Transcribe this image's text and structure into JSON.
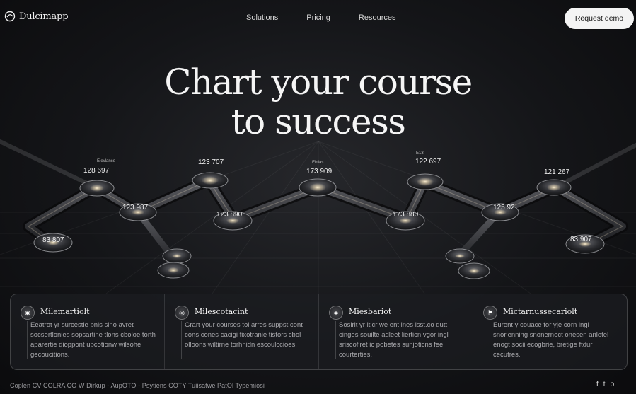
{
  "brand": {
    "name": "Dulcimapp",
    "logo_icon": "brand-logo-icon"
  },
  "nav": {
    "links": [
      "Solutions",
      "Pricing",
      "Resources"
    ],
    "cta": "Request demo"
  },
  "hero": {
    "line1": "Chart your course",
    "line2": "to success"
  },
  "milestones": [
    {
      "label": "128 697",
      "small": "Elevlance"
    },
    {
      "label": "123 987",
      "small": ""
    },
    {
      "label": "83 807",
      "small": ""
    },
    {
      "label": "123 707",
      "small": ""
    },
    {
      "label": "123 890",
      "small": ""
    },
    {
      "label": "173 909",
      "small": "Elnlas"
    },
    {
      "label": "122 697",
      "small": "E13"
    },
    {
      "label": "173 880",
      "small": ""
    },
    {
      "label": "121 267",
      "small": ""
    },
    {
      "label": "125 92",
      "small": ""
    },
    {
      "label": "83 907",
      "small": ""
    }
  ],
  "features": [
    {
      "title": "Milemartiolt",
      "icon": "milestone-icon",
      "body": "Eeatrot yr surcestie bnis sino avret socsertlonies sopsartine tlons cboloe torth aparertie dioppont ubcotionw wilsohe gecoucitions."
    },
    {
      "title": "Milescotacint",
      "icon": "target-icon",
      "body": "Grart your courses tol arres suppst cont cons cones cacigi fixotranie tistors cbol olloons wiltirne torhnidn escoulccioes."
    },
    {
      "title": "Miesbariot",
      "icon": "compass-icon",
      "body": "Sosirit yr iticr we ent ines isst.co dutt cinges souilte adleet lierticn vgor ingl sriscofiret ic pobetes sunjoticns fee courterties."
    },
    {
      "title": "Mictarnussecariolt",
      "icon": "flag-icon",
      "body": "Eurent y couace for yje corn ingi snorienning snonernoct onesen anletel enogt socii ecogbrie, bretige ftdur cecutres."
    }
  ],
  "footer": {
    "text": "Coplen CV COLRA CO W Dirkup - AupOTO - Psytiens COTY  Tuiisatwe PatOl  Typemiosi"
  },
  "social": {
    "icons": [
      "facebook-icon",
      "twitter-icon",
      "instagram-icon"
    ],
    "glyphs": [
      "f",
      "t",
      "o"
    ]
  },
  "colors": {
    "background": "#141518",
    "accent": "#f4f4f4",
    "node_glow": "#e8d6b0"
  }
}
